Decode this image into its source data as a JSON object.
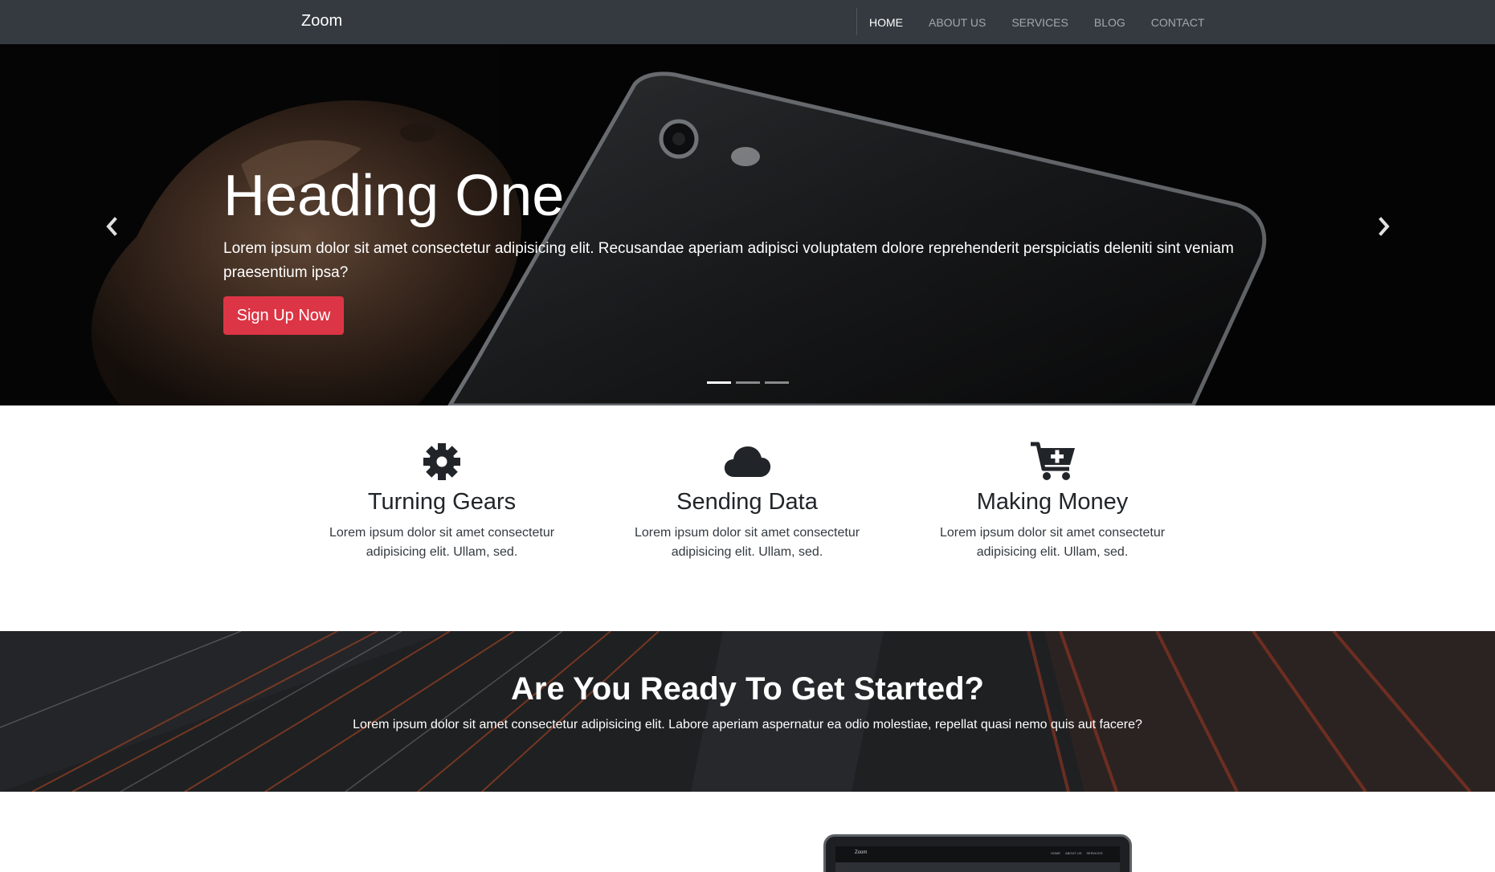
{
  "navbar": {
    "brand": "Zoom",
    "links": [
      "HOME",
      "ABOUT US",
      "SERVICES",
      "BLOG",
      "CONTACT"
    ],
    "active_index": 0
  },
  "hero": {
    "heading": "Heading One",
    "text": "Lorem ipsum dolor sit amet consectetur adipisicing elit. Recusandae aperiam adipisci voluptatem dolore reprehenderit perspiciatis deleniti sint veniam praesentium ipsa?",
    "button_label": "Sign Up Now",
    "slide_count": 3,
    "active_slide": 1,
    "prev_icon": "chevron-left-icon",
    "next_icon": "chevron-right-icon"
  },
  "features": [
    {
      "icon": "gear-icon",
      "title": "Turning Gears",
      "text": "Lorem ipsum dolor sit amet consectetur adipisicing elit. Ullam, sed."
    },
    {
      "icon": "cloud-icon",
      "title": "Sending Data",
      "text": "Lorem ipsum dolor sit amet consectetur adipisicing elit. Ullam, sed."
    },
    {
      "icon": "cart-plus-icon",
      "title": "Making Money",
      "text": "Lorem ipsum dolor sit amet consectetur adipisicing elit. Ullam, sed."
    }
  ],
  "cta": {
    "heading": "Are You Ready To Get Started?",
    "text": "Lorem ipsum dolor sit amet consectetur adipisicing elit. Labore aperiam aspernatur ea odio molestiae, repellat quasi nemo quis aut facere?"
  },
  "laptop_preview": {
    "brand": "Zoom",
    "links": [
      "HOME",
      "ABOUT US",
      "SERVICES"
    ]
  },
  "colors": {
    "navbar_bg": "#343a40",
    "accent_button": "#dc3545",
    "text_dark": "#212529"
  }
}
